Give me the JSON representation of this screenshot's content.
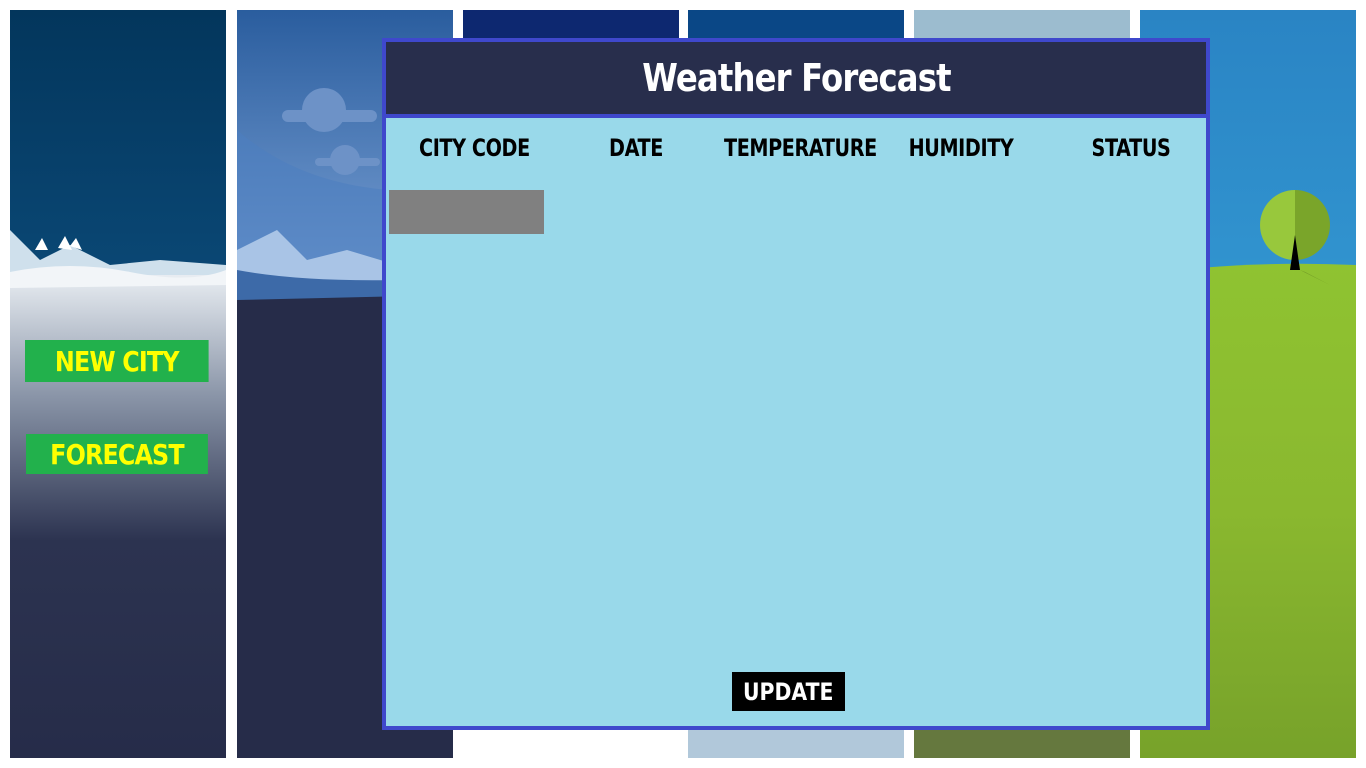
{
  "sidebar": {
    "new_city_label": "NEW CITY",
    "forecast_label": "FORECAST"
  },
  "modal": {
    "title": "Weather Forecast",
    "columns": [
      "CITY CODE",
      "DATE",
      "TEMPERATURE",
      "HUMIDITY",
      "STATUS"
    ],
    "update_label": "UPDATE"
  },
  "colors": {
    "sidebar_button_bg": "#22b14c",
    "sidebar_button_text": "#ffff00",
    "modal_border": "#3f48cc",
    "modal_header_bg": "#282e4c",
    "modal_body_bg": "#99d9ea",
    "city_select_bg": "#808080",
    "update_button_bg": "#000000"
  }
}
